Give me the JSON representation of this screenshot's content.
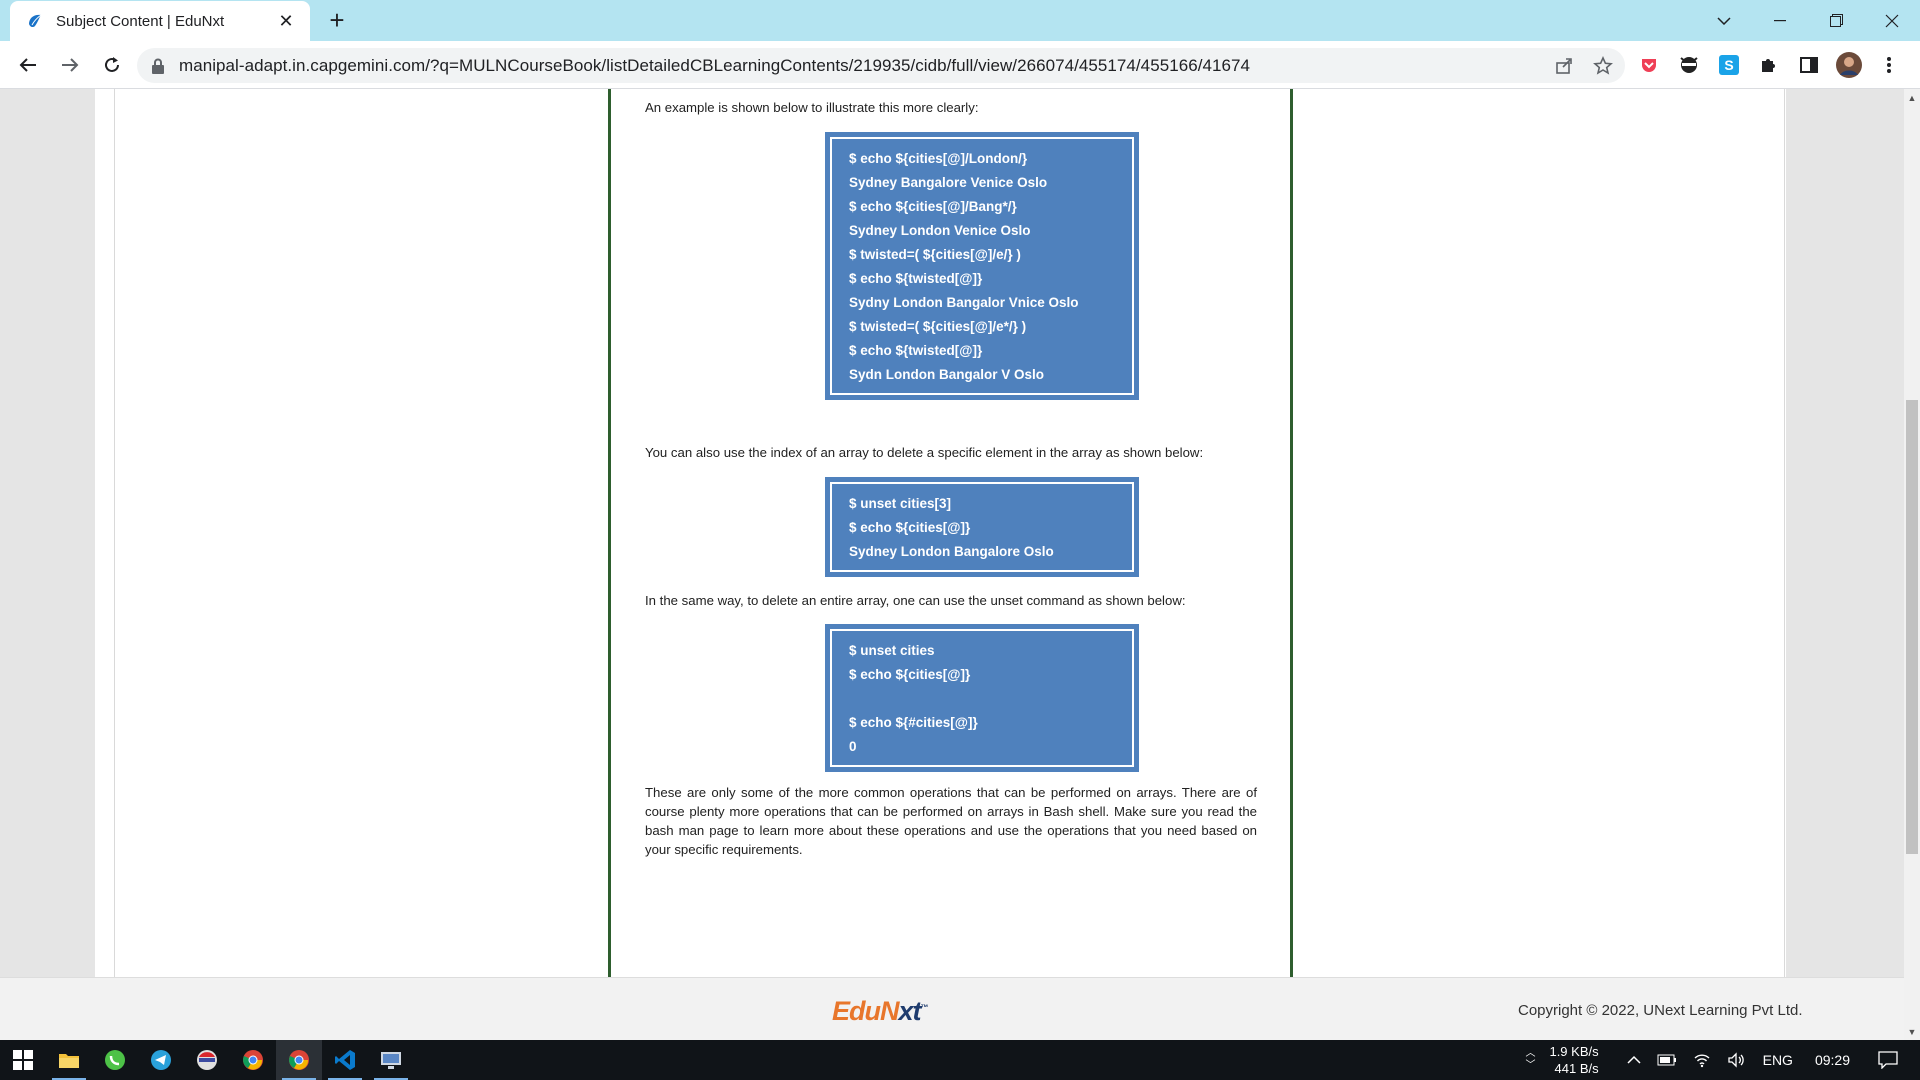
{
  "browser": {
    "tab_title": "Subject Content | EduNxt",
    "url": "manipal-adapt.in.capgemini.com/?q=MULNCourseBook/listDetailedCBLearningContents/219935/cidb/full/view/266074/455174/455166/41674"
  },
  "content": {
    "intro_text": "An example is shown below to illustrate this more clearly:",
    "code_block_1": [
      "$ echo ${cities[@]/London/}",
      "Sydney Bangalore Venice Oslo",
      "$ echo ${cities[@]/Bang*/}",
      "Sydney London Venice Oslo",
      "$ twisted=( ${cities[@]/e/} )",
      "$ echo ${twisted[@]}",
      "Sydny London Bangalor Vnice Oslo",
      "$ twisted=( ${cities[@]/e*/} )",
      "$ echo ${twisted[@]}",
      "Sydn London Bangalor V Oslo"
    ],
    "index_text": "You can also use the index of an array to delete a specific element in the array as shown below:",
    "code_block_2": [
      "$ unset cities[3]",
      "$ echo ${cities[@]}",
      "Sydney London Bangalore Oslo"
    ],
    "unset_text": "In the same way, to delete an entire array, one can use the unset command as shown below:",
    "code_block_3": [
      "$ unset cities",
      "$ echo ${cities[@]}",
      "",
      "$ echo ${#cities[@]}",
      "0"
    ],
    "closing_text": "These are only some of the more common operations that can be performed on arrays. There are of course plenty more operations that can be performed on arrays in Bash shell. Make sure you read the bash man page to learn more about these operations and use the operations that you need based on your specific requirements."
  },
  "footer": {
    "logo_edu": "EduN",
    "logo_xt": "xt",
    "logo_tm": "™",
    "copyright": "Copyright © 2022, UNext Learning Pvt Ltd."
  },
  "taskbar": {
    "net_up": "1.9 KB/s",
    "net_down": "441 B/s",
    "language": "ENG",
    "time": "09:29"
  },
  "colors": {
    "code_bg": "#4f81bd",
    "column_border": "#2e5e2e",
    "logo_orange": "#e8762b",
    "logo_navy": "#1f3c6e",
    "titlebar": "#b4e4f1"
  }
}
